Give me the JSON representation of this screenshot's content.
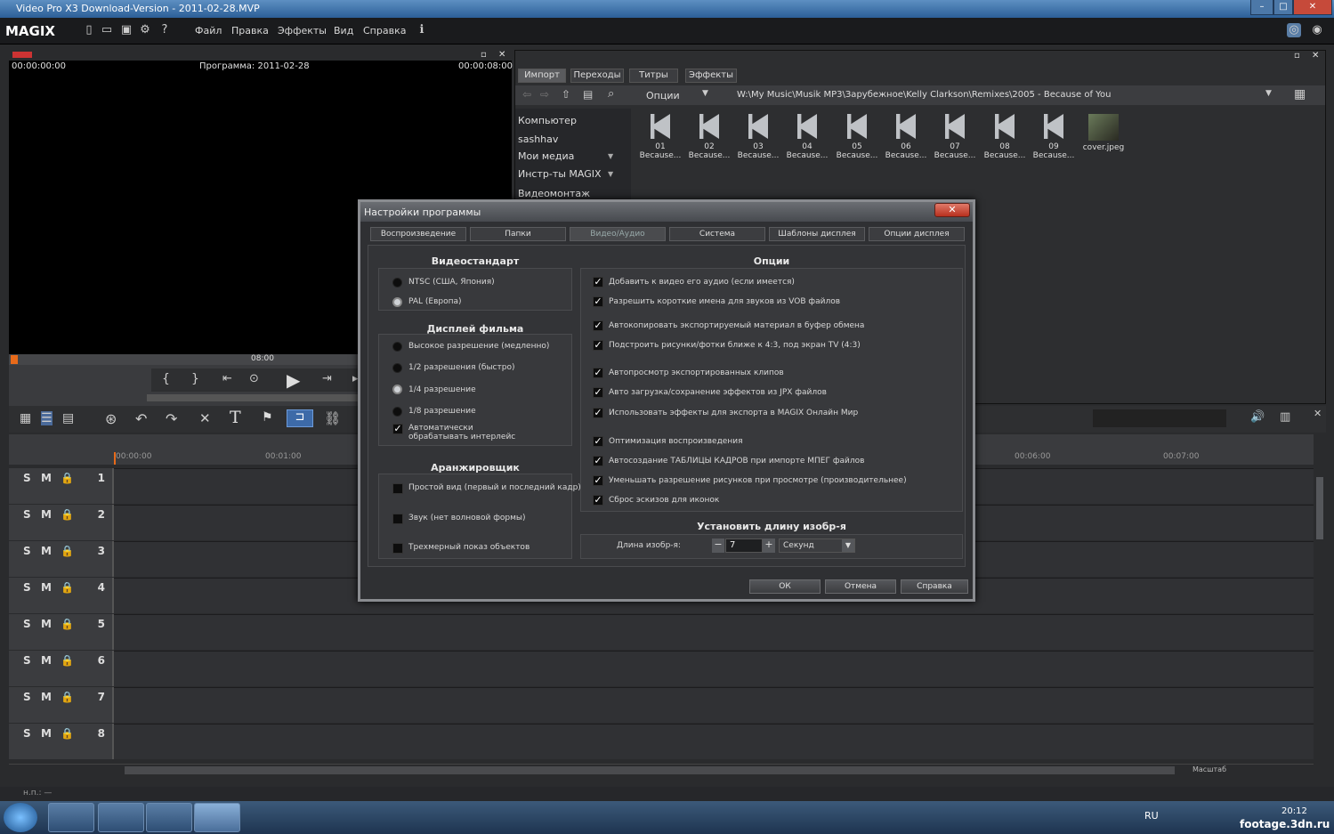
{
  "window": {
    "title": "Video Pro X3 Download-Version - 2011-02-28.MVP"
  },
  "app": {
    "logo": "MAGIX"
  },
  "menu": [
    "Файл",
    "Правка",
    "Эффекты",
    "Вид",
    "Справка"
  ],
  "preview": {
    "time_left": "00:00:00:00",
    "program": "Программа: 2011-02-28",
    "time_right": "00:00:08:00",
    "marker": "08:00"
  },
  "mediapool": {
    "tabs": [
      "Импорт",
      "Переходы",
      "Титры",
      "Эффекты"
    ],
    "options_label": "Опции",
    "path": "W:\\My Music\\Musik MP3\\Зарубежное\\Kelly Clarkson\\Remixes\\2005 - Because of You",
    "tree": [
      "Компьютер",
      "sashhav",
      "Мои медиа",
      "Инстр-ты MAGIX",
      "Видеомонтаж"
    ],
    "files": [
      {
        "num": "01",
        "name": "Because..."
      },
      {
        "num": "02",
        "name": "Because..."
      },
      {
        "num": "03",
        "name": "Because..."
      },
      {
        "num": "04",
        "name": "Because..."
      },
      {
        "num": "05",
        "name": "Because..."
      },
      {
        "num": "06",
        "name": "Because..."
      },
      {
        "num": "07",
        "name": "Because..."
      },
      {
        "num": "08",
        "name": "Because..."
      },
      {
        "num": "09",
        "name": "Because..."
      }
    ],
    "cover": "cover.jpeg"
  },
  "timeline": {
    "ruler": [
      "00:00:00",
      "00:01:00",
      "00:06:00",
      "00:07:00"
    ],
    "track_letters": {
      "s": "S",
      "m": "M"
    },
    "tracks": [
      "1",
      "2",
      "3",
      "4",
      "5",
      "6",
      "7",
      "8"
    ],
    "zoom_label": "Масштаб"
  },
  "status": {
    "text": "н.п.: —"
  },
  "taskbar": {
    "lang": "RU",
    "time": "20:12",
    "watermark": "footage.3dn.ru"
  },
  "dialog": {
    "title": "Настройки программы",
    "close": "✕",
    "tabs": [
      "Воспроизведение",
      "Папки",
      "Видео/Аудио",
      "Система",
      "Шаблоны дисплея",
      "Опции дисплея"
    ],
    "video_standard": {
      "title": "Видеостандарт",
      "options": [
        "NTSC (США, Япония)",
        "PAL (Европа)"
      ]
    },
    "film_display": {
      "title": "Дисплей фильма",
      "options": [
        "Высокое разрешение (медленно)",
        "1/2 разрешения (быстро)",
        "1/4 разрешение",
        "1/8 разрешение"
      ],
      "checkbox": "Автоматически обрабатывать интерлейс"
    },
    "arranger": {
      "title": "Аранжировщик",
      "options": [
        "Простой вид (первый и последний кадр)",
        "Звук (нет волновой формы)",
        "Трехмерный показ объектов"
      ]
    },
    "options": {
      "title": "Опции",
      "items": [
        "Добавить к видео его аудио (если имеется)",
        "Разрешить короткие имена для звуков из VOB файлов",
        "Автокопировать экспортируемый материал в буфер обмена",
        "Подстроить рисунки/фотки ближе к 4:3, под экран TV (4:3)",
        "Автопросмотр экспортированных клипов",
        "Авто загрузка/сохранение эффектов из JPX файлов",
        "Использовать эффекты для экспорта в MAGIX Онлайн Мир",
        "Оптимизация воспроизведения",
        "Автосоздание ТАБЛИЦЫ КАДРОВ при импорте МПЕГ файлов",
        "Уменьшать разрешение рисунков при просмотре (производительнее)",
        "Сброс эскизов для иконок"
      ]
    },
    "image_length": {
      "title": "Установить длину изобр-я",
      "label": "Длина изобр-я:",
      "value": "7",
      "unit": "Секунд"
    },
    "buttons": {
      "ok": "ОК",
      "cancel": "Отмена",
      "help": "Справка"
    }
  }
}
